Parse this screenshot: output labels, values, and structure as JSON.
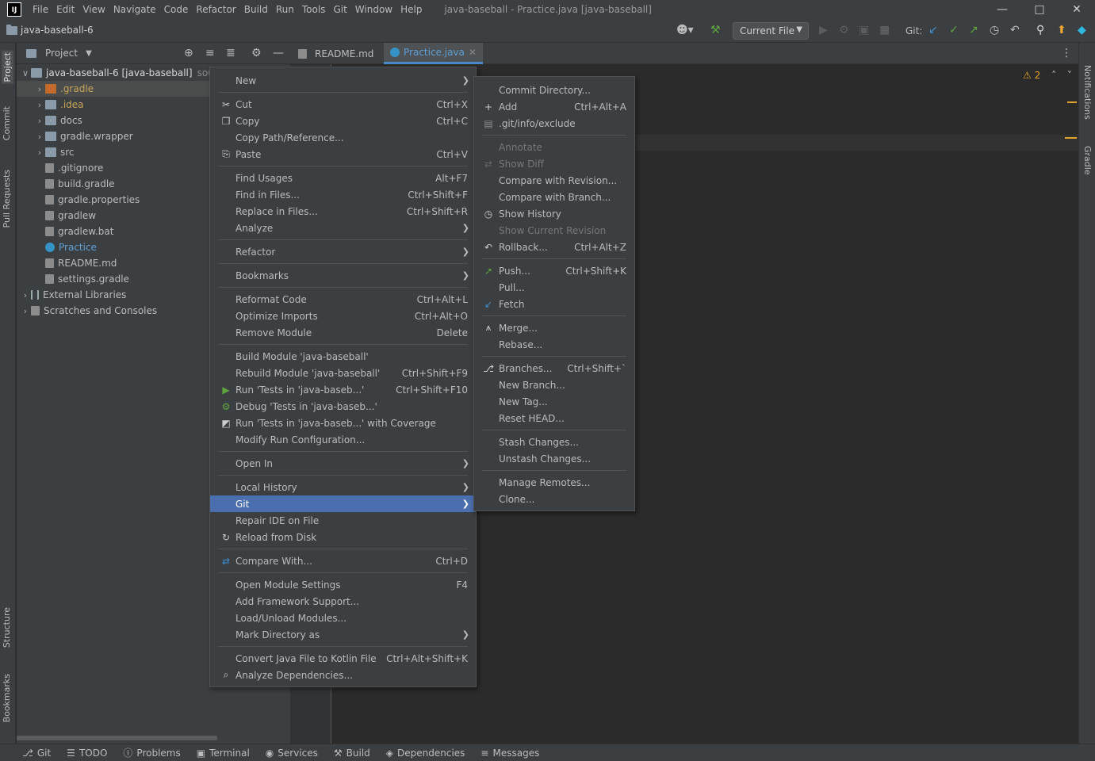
{
  "titlebar": {
    "menus": [
      "File",
      "Edit",
      "View",
      "Navigate",
      "Code",
      "Refactor",
      "Build",
      "Run",
      "Tools",
      "Git",
      "Window",
      "Help"
    ],
    "window_title": "java-baseball - Practice.java [java-baseball]"
  },
  "navbar": {
    "project_name": "java-baseball-6",
    "run_config": "Current File",
    "git_label": "Git:"
  },
  "left_stripe": [
    "Project",
    "Commit",
    "Pull Requests",
    "Structure",
    "Bookmarks"
  ],
  "right_stripe": [
    "Notifications",
    "Gradle"
  ],
  "project_panel": {
    "title": "Project",
    "tree": [
      {
        "label": "java-baseball-6 [java-baseball]",
        "suffix": "sourc",
        "level": 0,
        "expanded": true,
        "icon": "module-folder-icon"
      },
      {
        "label": ".gradle",
        "level": 1,
        "icon": "folder-icon",
        "color": "#c46a2b",
        "text_color": "#c9a55a",
        "selected": true
      },
      {
        "label": ".idea",
        "level": 1,
        "icon": "folder-icon",
        "text_color": "#c9a55a"
      },
      {
        "label": "docs",
        "level": 1,
        "icon": "folder-icon"
      },
      {
        "label": "gradle.wrapper",
        "level": 1,
        "icon": "folder-icon"
      },
      {
        "label": "src",
        "level": 1,
        "icon": "folder-icon"
      },
      {
        "label": ".gitignore",
        "level": 1,
        "icon": "file-icon"
      },
      {
        "label": "build.gradle",
        "level": 1,
        "icon": "gradle-icon"
      },
      {
        "label": "gradle.properties",
        "level": 1,
        "icon": "file-icon"
      },
      {
        "label": "gradlew",
        "level": 1,
        "icon": "file-icon"
      },
      {
        "label": "gradlew.bat",
        "level": 1,
        "icon": "file-icon"
      },
      {
        "label": "Practice",
        "level": 1,
        "icon": "java-icon",
        "text_color": "#5e9fd6"
      },
      {
        "label": "README.md",
        "level": 1,
        "icon": "file-icon"
      },
      {
        "label": "settings.gradle",
        "level": 1,
        "icon": "gradle-icon"
      },
      {
        "label": "External Libraries",
        "level": 0,
        "icon": "library-icon"
      },
      {
        "label": "Scratches and Consoles",
        "level": 0,
        "icon": "scratch-icon"
      }
    ]
  },
  "editor_tabs": [
    {
      "label": "README.md",
      "active": false
    },
    {
      "label": "Practice.java",
      "active": true
    }
  ],
  "editor": {
    "warnings": "2"
  },
  "context_menu": [
    {
      "label": "New",
      "sub": true
    },
    {
      "sep": true
    },
    {
      "label": "Cut",
      "shortcut": "Ctrl+X",
      "icon": "scissors-icon"
    },
    {
      "label": "Copy",
      "shortcut": "Ctrl+C",
      "icon": "copy-icon"
    },
    {
      "label": "Copy Path/Reference..."
    },
    {
      "label": "Paste",
      "shortcut": "Ctrl+V",
      "icon": "paste-icon"
    },
    {
      "sep": true
    },
    {
      "label": "Find Usages",
      "shortcut": "Alt+F7"
    },
    {
      "label": "Find in Files...",
      "shortcut": "Ctrl+Shift+F"
    },
    {
      "label": "Replace in Files...",
      "shortcut": "Ctrl+Shift+R"
    },
    {
      "label": "Analyze",
      "sub": true
    },
    {
      "sep": true
    },
    {
      "label": "Refactor",
      "sub": true
    },
    {
      "sep": true
    },
    {
      "label": "Bookmarks",
      "sub": true
    },
    {
      "sep": true
    },
    {
      "label": "Reformat Code",
      "shortcut": "Ctrl+Alt+L"
    },
    {
      "label": "Optimize Imports",
      "shortcut": "Ctrl+Alt+O"
    },
    {
      "label": "Remove Module",
      "shortcut": "Delete"
    },
    {
      "sep": true
    },
    {
      "label": "Build Module 'java-baseball'"
    },
    {
      "label": "Rebuild Module 'java-baseball'",
      "shortcut": "Ctrl+Shift+F9"
    },
    {
      "label": "Run 'Tests in 'java-baseb...'",
      "shortcut": "Ctrl+Shift+F10",
      "icon": "run-icon"
    },
    {
      "label": "Debug 'Tests in 'java-baseb...'",
      "icon": "debug-icon"
    },
    {
      "label": "Run 'Tests in 'java-baseb...' with Coverage",
      "icon": "coverage-icon"
    },
    {
      "label": "Modify Run Configuration..."
    },
    {
      "sep": true
    },
    {
      "label": "Open In",
      "sub": true
    },
    {
      "sep": true
    },
    {
      "label": "Local History",
      "sub": true
    },
    {
      "label": "Git",
      "sub": true,
      "highlight": true
    },
    {
      "label": "Repair IDE on File"
    },
    {
      "label": "Reload from Disk",
      "icon": "reload-icon"
    },
    {
      "sep": true
    },
    {
      "label": "Compare With...",
      "shortcut": "Ctrl+D",
      "icon": "compare-icon"
    },
    {
      "sep": true
    },
    {
      "label": "Open Module Settings",
      "shortcut": "F4"
    },
    {
      "label": "Add Framework Support..."
    },
    {
      "label": "Load/Unload Modules..."
    },
    {
      "label": "Mark Directory as",
      "sub": true
    },
    {
      "sep": true
    },
    {
      "label": "Convert Java File to Kotlin File",
      "shortcut": "Ctrl+Alt+Shift+K"
    },
    {
      "label": "Analyze Dependencies...",
      "icon": "analyze-icon"
    }
  ],
  "git_submenu": [
    {
      "label": "Commit Directory..."
    },
    {
      "label": "Add",
      "shortcut": "Ctrl+Alt+A",
      "icon": "plus-icon"
    },
    {
      "label": ".git/info/exclude",
      "icon": "gitignore-icon"
    },
    {
      "sep": true
    },
    {
      "label": "Annotate",
      "disabled": true
    },
    {
      "label": "Show Diff",
      "disabled": true,
      "icon": "diff-icon"
    },
    {
      "label": "Compare with Revision..."
    },
    {
      "label": "Compare with Branch..."
    },
    {
      "label": "Show History",
      "icon": "clock-icon"
    },
    {
      "label": "Show Current Revision",
      "disabled": true
    },
    {
      "label": "Rollback...",
      "shortcut": "Ctrl+Alt+Z",
      "icon": "rollback-icon"
    },
    {
      "sep": true
    },
    {
      "label": "Push...",
      "shortcut": "Ctrl+Shift+K",
      "icon": "push-icon"
    },
    {
      "label": "Pull..."
    },
    {
      "label": "Fetch",
      "icon": "fetch-icon"
    },
    {
      "sep": true
    },
    {
      "label": "Merge...",
      "icon": "merge-icon"
    },
    {
      "label": "Rebase..."
    },
    {
      "sep": true
    },
    {
      "label": "Branches...",
      "shortcut": "Ctrl+Shift+`",
      "icon": "branch-icon"
    },
    {
      "label": "New Branch..."
    },
    {
      "label": "New Tag..."
    },
    {
      "label": "Reset HEAD..."
    },
    {
      "sep": true
    },
    {
      "label": "Stash Changes..."
    },
    {
      "label": "Unstash Changes..."
    },
    {
      "sep": true
    },
    {
      "label": "Manage Remotes..."
    },
    {
      "label": "Clone..."
    }
  ],
  "bottom_bar": [
    {
      "label": "Git",
      "icon": "branch-icon"
    },
    {
      "label": "TODO",
      "icon": "list-icon"
    },
    {
      "label": "Problems",
      "icon": "problems-icon"
    },
    {
      "label": "Terminal",
      "icon": "terminal-icon"
    },
    {
      "label": "Services",
      "icon": "services-icon"
    },
    {
      "label": "Build",
      "icon": "hammer-icon"
    },
    {
      "label": "Dependencies",
      "icon": "layers-icon"
    },
    {
      "label": "Messages",
      "icon": "messages-icon"
    }
  ]
}
